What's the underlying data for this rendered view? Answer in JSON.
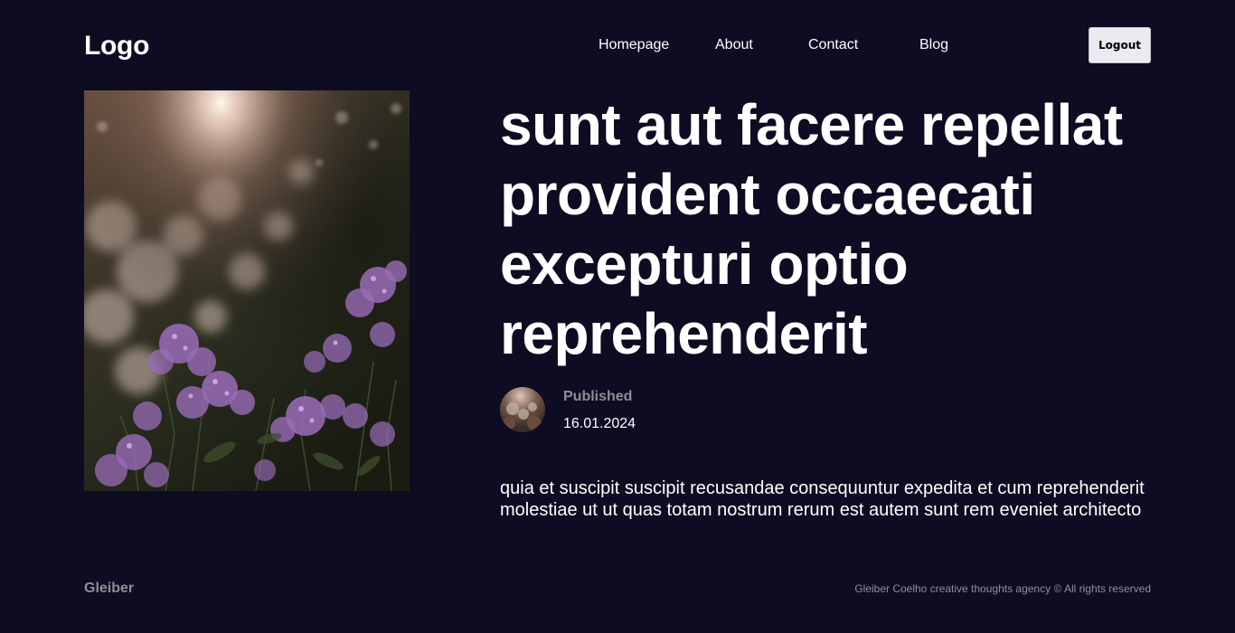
{
  "header": {
    "logo": "Logo",
    "nav": [
      {
        "label": "Homepage"
      },
      {
        "label": "About"
      },
      {
        "label": "Contact"
      },
      {
        "label": "Blog"
      }
    ],
    "logout_label": "Logout"
  },
  "post": {
    "image_icon": "flower-photo",
    "title": "sunt aut facere repellat provident occaecati excepturi optio reprehenderit",
    "published_label": "Published",
    "published_date": "16.01.2024",
    "body": "quia et suscipit suscipit recusandae consequuntur expedita et cum reprehenderit molestiae ut ut quas totam nostrum rerum est autem sunt rem eveniet architecto"
  },
  "footer": {
    "brand": "Gleiber",
    "copyright": "Gleiber Coelho creative thoughts agency © All rights reserved"
  },
  "colors": {
    "background": "#0d0c22",
    "text": "#ffffff",
    "muted": "#8f8e97",
    "button_bg": "#ebeaf0"
  }
}
